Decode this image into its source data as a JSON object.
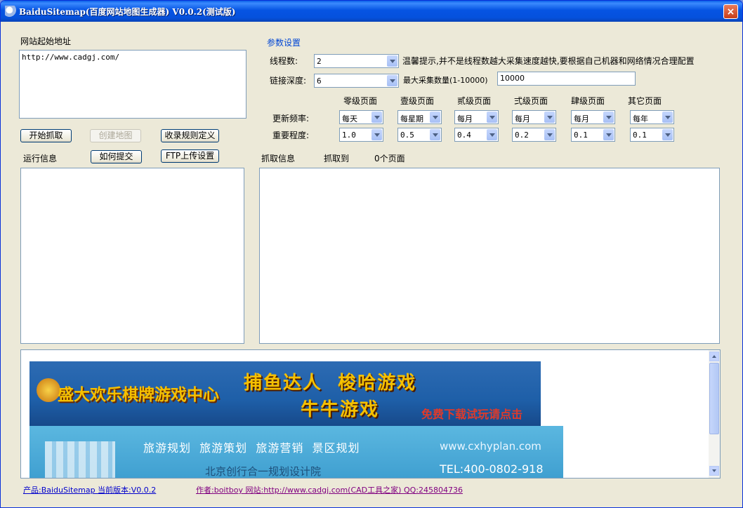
{
  "window": {
    "title": "BaiduSitemap(百度网站地图生成器) V0.0.2(测试版)",
    "close_glyph": "×"
  },
  "left": {
    "url_label": "网站起始地址",
    "url_value": "http://www.cadgj.com/",
    "btn_start": "开始抓取",
    "btn_create": "创建地图",
    "btn_rules": "收录规则定义",
    "run_label": "运行信息",
    "btn_submit": "如何提交",
    "btn_ftp": "FTP上传设置"
  },
  "params": {
    "title": "参数设置",
    "threads_label": "线程数:",
    "threads_value": "2",
    "threads_hint": "温馨提示,并不是线程数越大采集速度越快,要根据自己机器和网络情况合理配置",
    "depth_label": "链接深度:",
    "depth_value": "6",
    "max_label": "最大采集数量(1-10000)",
    "max_value": "10000",
    "columns": [
      "零级页面",
      "壹级页面",
      "贰级页面",
      "弍级页面",
      "肆级页面",
      "其它页面"
    ],
    "freq_label": "更新频率:",
    "freq_values": [
      "每天",
      "每星期",
      "每月",
      "每月",
      "每月",
      "每年"
    ],
    "prio_label": "重要程度:",
    "prio_values": [
      "1.0",
      "0.5",
      "0.4",
      "0.2",
      "0.1",
      "0.1"
    ]
  },
  "crawl": {
    "label": "抓取信息",
    "fetched_label": "抓取到",
    "count_text": "0个页面"
  },
  "banner1": {
    "brand": "盛大欢乐棋牌游戏中心",
    "games_line1": "捕鱼达人  梭哈游戏",
    "games_line2": "牛牛游戏",
    "cta": "免费下载试玩请点击"
  },
  "banner2": {
    "services": "旅游规划  旅游策划  旅游营销  景区规划",
    "site": "www.cxhyplan.com",
    "company": "北京创行合一规划设计院",
    "tel": "TEL:400-0802-918"
  },
  "footer": {
    "product_link": "产品:BaiduSitemap 当前版本:V0.0.2",
    "author_link": "作者:boitboy 网站:http://www.cadgj.com(CAD工具之家) QQ:245804736"
  },
  "colors": {
    "titlebar": "#0654e3",
    "window_bg": "#ece9d8",
    "banner1_bg": "#1e5fa8",
    "banner2_bg": "#4aa9d6",
    "gold": "#f5c000",
    "cta_red": "#e03a2a"
  }
}
